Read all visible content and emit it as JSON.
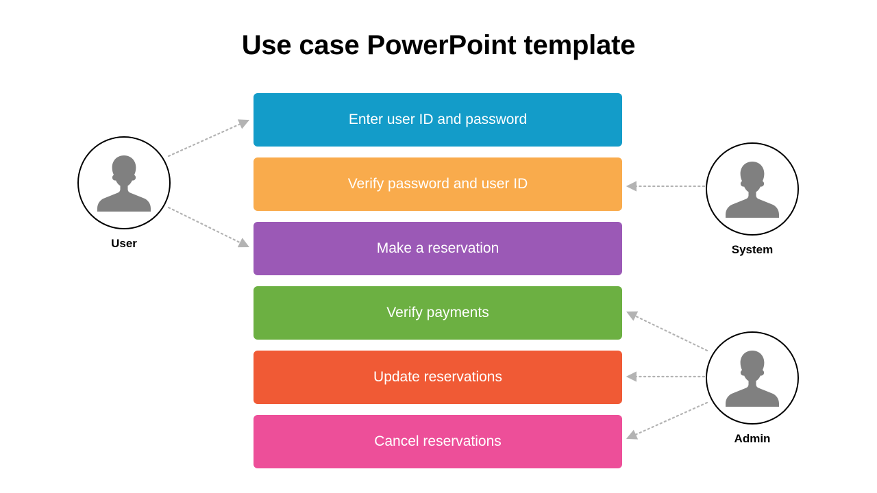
{
  "slide": {
    "title": "Use case PowerPoint template",
    "background_color": "#ffffff",
    "title_color": "#000000"
  },
  "use_cases": [
    {
      "label": "Enter user ID and password",
      "color": "#139cc9",
      "text_color": "#ffffff"
    },
    {
      "label": "Verify password and user ID",
      "color": "#f9ab4c",
      "text_color": "#ffffff"
    },
    {
      "label": "Make a reservation",
      "color": "#9b59b6",
      "text_color": "#ffffff"
    },
    {
      "label": "Verify payments",
      "color": "#6cb042",
      "text_color": "#ffffff"
    },
    {
      "label": "Update reservations",
      "color": "#f05a35",
      "text_color": "#ffffff"
    },
    {
      "label": "Cancel reservations",
      "color": "#ed4f99",
      "text_color": "#ffffff"
    }
  ],
  "actors": [
    {
      "name": "User",
      "label": "User",
      "icon": "person-silhouette-icon",
      "icon_color": "#808080",
      "ring_color": "#000000"
    },
    {
      "name": "System",
      "label": "System",
      "icon": "person-silhouette-icon",
      "icon_color": "#808080",
      "ring_color": "#000000"
    },
    {
      "name": "Admin",
      "label": "Admin",
      "icon": "person-silhouette-icon",
      "icon_color": "#808080",
      "ring_color": "#000000"
    }
  ],
  "connectors": {
    "style": "dotted-arrow",
    "color": "#b3b3b3",
    "links": [
      {
        "from": "User",
        "to": "Enter user ID and password"
      },
      {
        "from": "User",
        "to": "Make a reservation"
      },
      {
        "from": "System",
        "to": "Verify password and user ID"
      },
      {
        "from": "Admin",
        "to": "Verify payments"
      },
      {
        "from": "Admin",
        "to": "Update reservations"
      },
      {
        "from": "Admin",
        "to": "Cancel reservations"
      }
    ]
  }
}
